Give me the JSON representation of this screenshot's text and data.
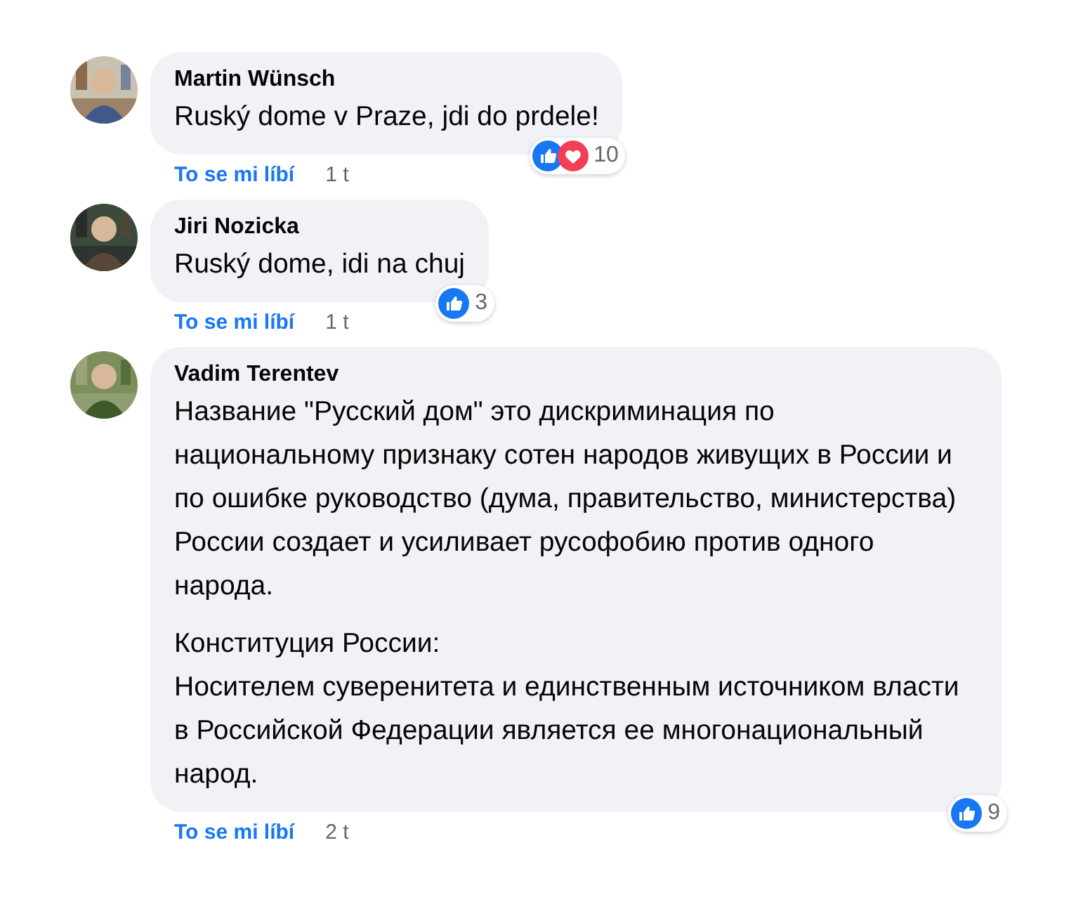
{
  "comments": [
    {
      "author": "Martin Wünsch",
      "avatar": {
        "kind": "picture"
      },
      "paragraphs": [
        "Ruský dome v Praze, jdi do prdele!"
      ],
      "reactions": [
        {
          "kind": "like"
        },
        {
          "kind": "love"
        }
      ],
      "reaction_count": "10",
      "like_label": "To se mi líbí",
      "time": "1 t"
    },
    {
      "author": "Jiri Nozicka",
      "avatar": {
        "kind": "picture"
      },
      "paragraphs": [
        "Ruský dome, idi na chuj"
      ],
      "reactions": [
        {
          "kind": "like"
        }
      ],
      "reaction_count": "3",
      "like_label": "To se mi líbí",
      "time": "1 t"
    },
    {
      "author": "Vadim Terentev",
      "avatar": {
        "kind": "picture"
      },
      "paragraphs": [
        "Название \"Русский дом\" это дискриминация по национальному признаку сотен народов живущих в России и по ошибке руководство (дума, правительство, министерства) России создает и усиливает русофобию против одного народа.",
        "Конституция России:\nНосителем суверенитета и единственным источником власти в Российской Федерации является ее многонациональный народ."
      ],
      "reactions": [
        {
          "kind": "like"
        }
      ],
      "reaction_count": "9",
      "like_label": "To se mi líbí",
      "time": "2 t"
    }
  ]
}
